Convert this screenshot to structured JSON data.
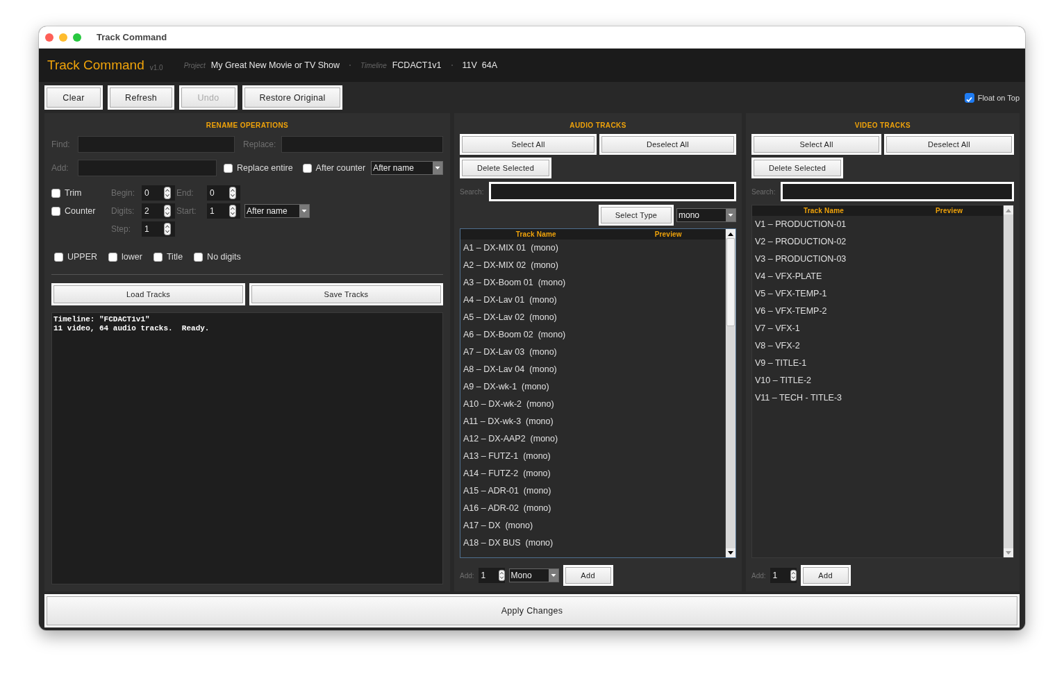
{
  "window": {
    "title": "Track Command"
  },
  "header": {
    "app_name": "Track Command",
    "version": "v1.0",
    "project_label": "Project",
    "project": "My Great New Movie or TV Show",
    "timeline_label": "Timeline",
    "timeline": "FCDACT1v1",
    "counts": "11V  64A"
  },
  "toolbar": {
    "buttons": [
      {
        "label": "Clear",
        "disabled": false
      },
      {
        "label": "Refresh",
        "disabled": false
      },
      {
        "label": "Undo",
        "disabled": true
      },
      {
        "label": "Restore Original",
        "disabled": false
      }
    ],
    "float_on_top": {
      "label": "Float on Top",
      "checked": true
    }
  },
  "rename": {
    "title": "RENAME OPERATIONS",
    "find_label": "Find:",
    "replace_label": "Replace:",
    "add_label": "Add:",
    "options": [
      {
        "label": "Replace entire",
        "checked": false
      },
      {
        "label": "After counter",
        "checked": false
      }
    ],
    "position_select": "After name",
    "trim": {
      "label": "Trim",
      "checked": false
    },
    "begin_label": "Begin:",
    "begin": "0",
    "end_label": "End:",
    "end": "0",
    "counter": {
      "label": "Counter",
      "checked": false
    },
    "digits_label": "Digits:",
    "digits": "2",
    "start_label": "Start:",
    "start": "1",
    "counter_position": "After name",
    "step_label": "Step:",
    "step": "1",
    "case_options": [
      {
        "label": "UPPER",
        "checked": false
      },
      {
        "label": "lower",
        "checked": false
      },
      {
        "label": "Title",
        "checked": false
      },
      {
        "label": "No digits",
        "checked": false
      }
    ],
    "load_button": "Load Tracks",
    "save_button": "Save Tracks",
    "log": [
      "Timeline: \"FCDACT1v1\"",
      "11 video, 64 audio tracks.  Ready."
    ]
  },
  "audio": {
    "title": "AUDIO TRACKS",
    "select_all": "Select All",
    "deselect_all": "Deselect All",
    "delete_selected": "Delete Selected",
    "search_label": "Search:",
    "select_type": "Select Type",
    "type_value": "mono",
    "columns": [
      "Track Name",
      "Preview"
    ],
    "rows": [
      "A1 – DX-MIX 01  (mono)",
      "A2 – DX-MIX 02  (mono)",
      "A3 – DX-Boom 01  (mono)",
      "A4 – DX-Lav 01  (mono)",
      "A5 – DX-Lav 02  (mono)",
      "A6 – DX-Boom 02  (mono)",
      "A7 – DX-Lav 03  (mono)",
      "A8 – DX-Lav 04  (mono)",
      "A9 – DX-wk-1  (mono)",
      "A10 – DX-wk-2  (mono)",
      "A11 – DX-wk-3  (mono)",
      "A12 – DX-AAP2  (mono)",
      "A13 – FUTZ-1  (mono)",
      "A14 – FUTZ-2  (mono)",
      "A15 – ADR-01  (mono)",
      "A16 – ADR-02  (mono)",
      "A17 – DX  (mono)",
      "A18 – DX BUS  (mono)"
    ],
    "add_label": "Add:",
    "add_count": "1",
    "add_type": "Mono",
    "add_button": "Add"
  },
  "video": {
    "title": "VIDEO TRACKS",
    "select_all": "Select All",
    "deselect_all": "Deselect All",
    "delete_selected": "Delete Selected",
    "search_label": "Search:",
    "columns": [
      "Track Name",
      "Preview"
    ],
    "rows": [
      "V1 – PRODUCTION-01",
      "V2 – PRODUCTION-02",
      "V3 – PRODUCTION-03",
      "V4 – VFX-PLATE",
      "V5 – VFX-TEMP-1",
      "V6 – VFX-TEMP-2",
      "V7 – VFX-1",
      "V8 – VFX-2",
      "V9 – TITLE-1",
      "V10 – TITLE-2",
      "V11 – TECH - TITLE-3"
    ],
    "add_label": "Add:",
    "add_count": "1",
    "add_button": "Add"
  },
  "apply_button": "Apply Changes"
}
